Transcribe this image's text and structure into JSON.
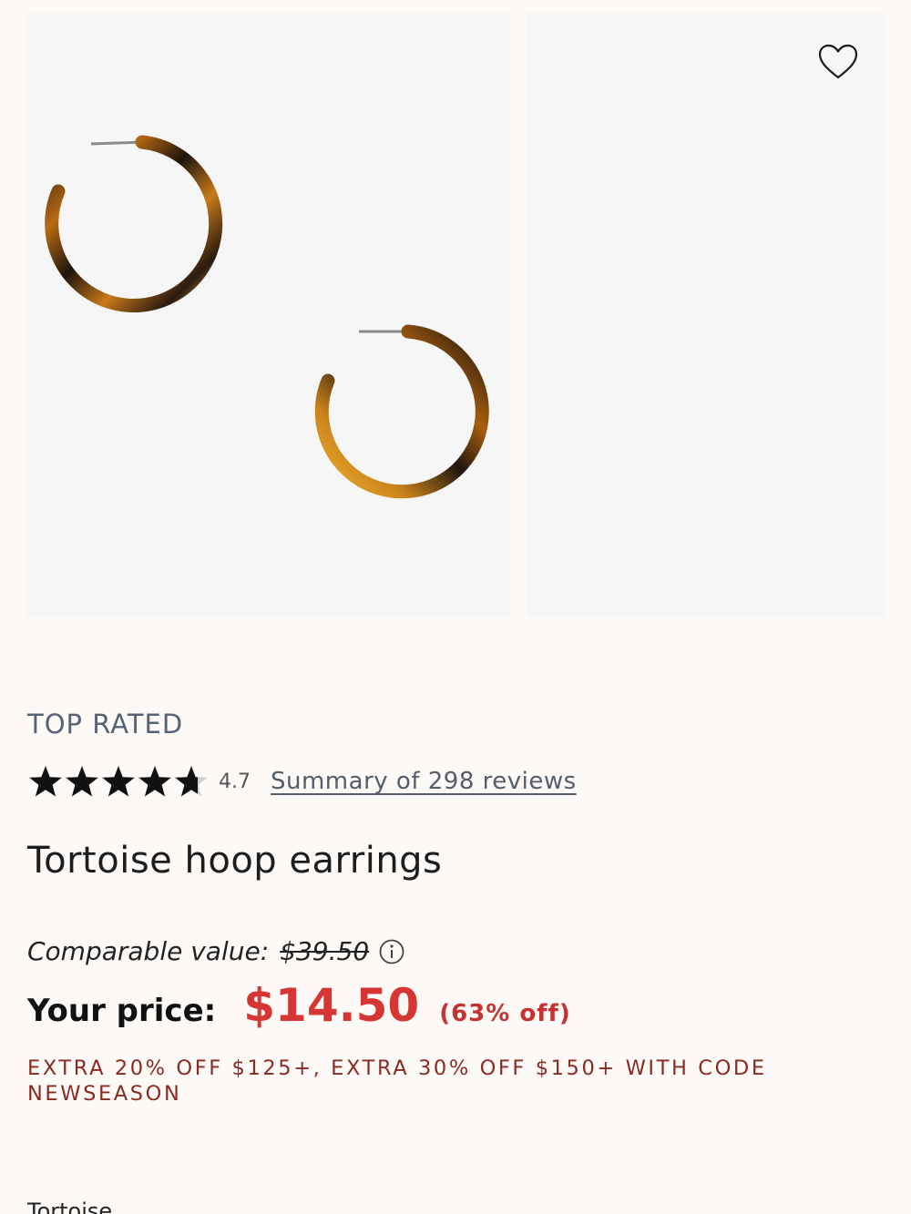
{
  "product": {
    "badge": "TOP RATED",
    "rating": 4.7,
    "rating_text": "4.7",
    "stars_max": 5,
    "reviews_link": "Summary of 298 reviews",
    "title": "Tortoise hoop earrings",
    "comparable_label": "Comparable value:",
    "comparable_price": "$39.50",
    "price_label": "Your price:",
    "price": "$14.50",
    "discount": "(63% off)",
    "promo_line1": "EXTRA 20% OFF $125+, EXTRA 30% OFF $150+ WITH CODE",
    "promo_line2": "NEWSEASON",
    "color_name": "Tortoise"
  },
  "colors": {
    "background": "#fcf9f7",
    "image_bg": "#f6f6f7",
    "badge": "#566276",
    "price": "#d63633",
    "promo": "#8a2a22"
  },
  "icons": {
    "favorite": "heart-outline-icon",
    "info": "info-circle-icon",
    "star": "star-icon"
  }
}
